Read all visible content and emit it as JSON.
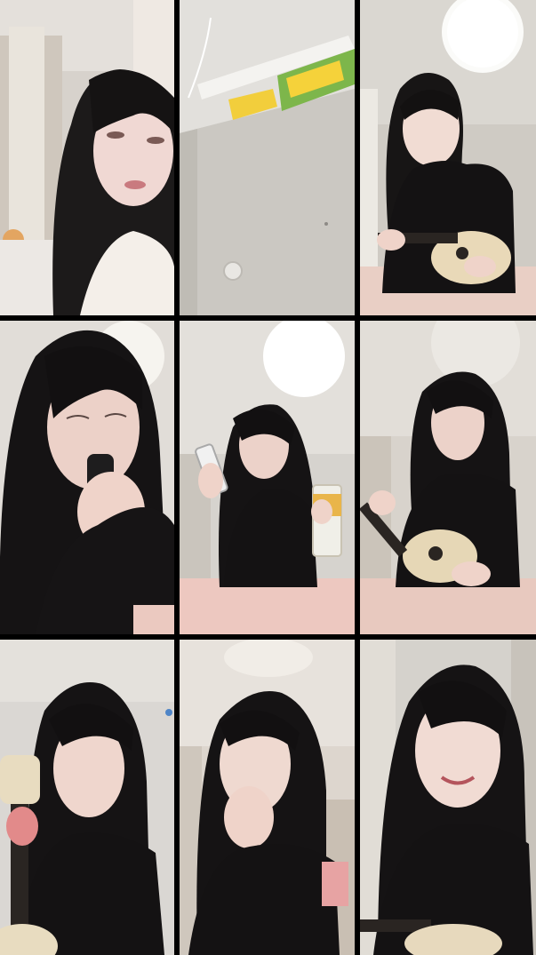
{
  "grid": {
    "rows": 3,
    "columns": 3,
    "background_color": "#000000",
    "tiles": [
      {
        "id": "tile-1",
        "subject": "selfie-closeup",
        "wall_color": "#d9d4cf",
        "accent": "#efe9e3"
      },
      {
        "id": "tile-2",
        "subject": "ceiling-view",
        "wall_color": "#d6d4cf",
        "accent": "#f2ce3c"
      },
      {
        "id": "tile-3",
        "subject": "person-with-ukulele",
        "wall_color": "#dcd9d3",
        "accent": "#e9d9b8"
      },
      {
        "id": "tile-4",
        "subject": "person-eyes-closed",
        "wall_color": "#e3dfda",
        "accent": "#f6f4ef"
      },
      {
        "id": "tile-5",
        "subject": "person-with-phone-and-drink",
        "wall_color": "#d9d6d0",
        "accent": "#f7f6f2"
      },
      {
        "id": "tile-6",
        "subject": "person-with-ukulele",
        "wall_color": "#d8d3cc",
        "accent": "#e6d7b6"
      },
      {
        "id": "tile-7",
        "subject": "person-holding-ukulele",
        "wall_color": "#dad7d3",
        "accent": "#e8dcc0"
      },
      {
        "id": "tile-8",
        "subject": "person-hand-at-mouth",
        "wall_color": "#ddd6ce",
        "accent": "#ece6de"
      },
      {
        "id": "tile-9",
        "subject": "person-smiling",
        "wall_color": "#d5d2cc",
        "accent": "#e7d9bd"
      }
    ]
  }
}
